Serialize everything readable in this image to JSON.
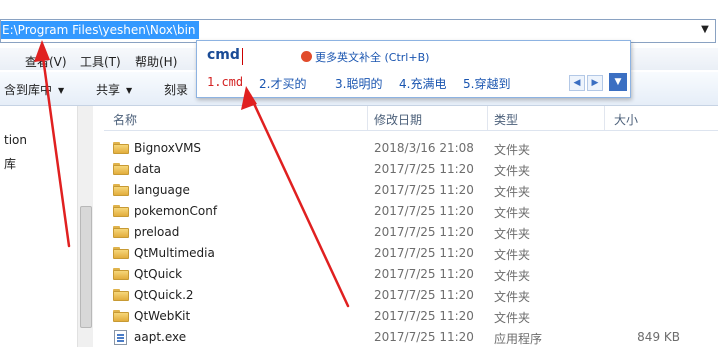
{
  "address": {
    "path": "E:\\Program Files\\yeshen\\Nox\\bin",
    "dropdown_icon": "chevron-down-icon"
  },
  "menubar": {
    "items": [
      "查看(V)",
      "工具(T)",
      "帮助(H)"
    ]
  },
  "toolbar": {
    "include_in_library": "含到库中",
    "share": "共享",
    "burn": "刻录"
  },
  "ime": {
    "composition": "cmd",
    "hint": "更多英文补全 (Ctrl+B)",
    "candidates": [
      "1.cmd",
      "2.才买的",
      "3.聪明的",
      "4.充满电",
      "5.穿越到"
    ],
    "colors": {
      "composition": "#1a4b96",
      "candidate_selected": "#d32222",
      "candidate": "#1a55b0"
    }
  },
  "navpane": {
    "items": [
      "tion",
      "库"
    ]
  },
  "columns": {
    "name": "名称",
    "date": "修改日期",
    "type": "类型",
    "size": "大小"
  },
  "files": [
    {
      "name": "BignoxVMS",
      "date": "2018/3/16 21:08",
      "type": "文件夹",
      "size": "",
      "icon": "folder-icon"
    },
    {
      "name": "data",
      "date": "2017/7/25 11:20",
      "type": "文件夹",
      "size": "",
      "icon": "folder-icon"
    },
    {
      "name": "language",
      "date": "2017/7/25 11:20",
      "type": "文件夹",
      "size": "",
      "icon": "folder-icon"
    },
    {
      "name": "pokemonConf",
      "date": "2017/7/25 11:20",
      "type": "文件夹",
      "size": "",
      "icon": "folder-icon"
    },
    {
      "name": "preload",
      "date": "2017/7/25 11:20",
      "type": "文件夹",
      "size": "",
      "icon": "folder-icon"
    },
    {
      "name": "QtMultimedia",
      "date": "2017/7/25 11:20",
      "type": "文件夹",
      "size": "",
      "icon": "folder-icon"
    },
    {
      "name": "QtQuick",
      "date": "2017/7/25 11:20",
      "type": "文件夹",
      "size": "",
      "icon": "folder-icon"
    },
    {
      "name": "QtQuick.2",
      "date": "2017/7/25 11:20",
      "type": "文件夹",
      "size": "",
      "icon": "folder-icon"
    },
    {
      "name": "QtWebKit",
      "date": "2017/7/25 11:20",
      "type": "文件夹",
      "size": "",
      "icon": "folder-icon"
    },
    {
      "name": "aapt.exe",
      "date": "2017/7/25 11:20",
      "type": "应用程序",
      "size": "849 KB",
      "icon": "exe-icon"
    }
  ],
  "annotation_color": "#e02020"
}
